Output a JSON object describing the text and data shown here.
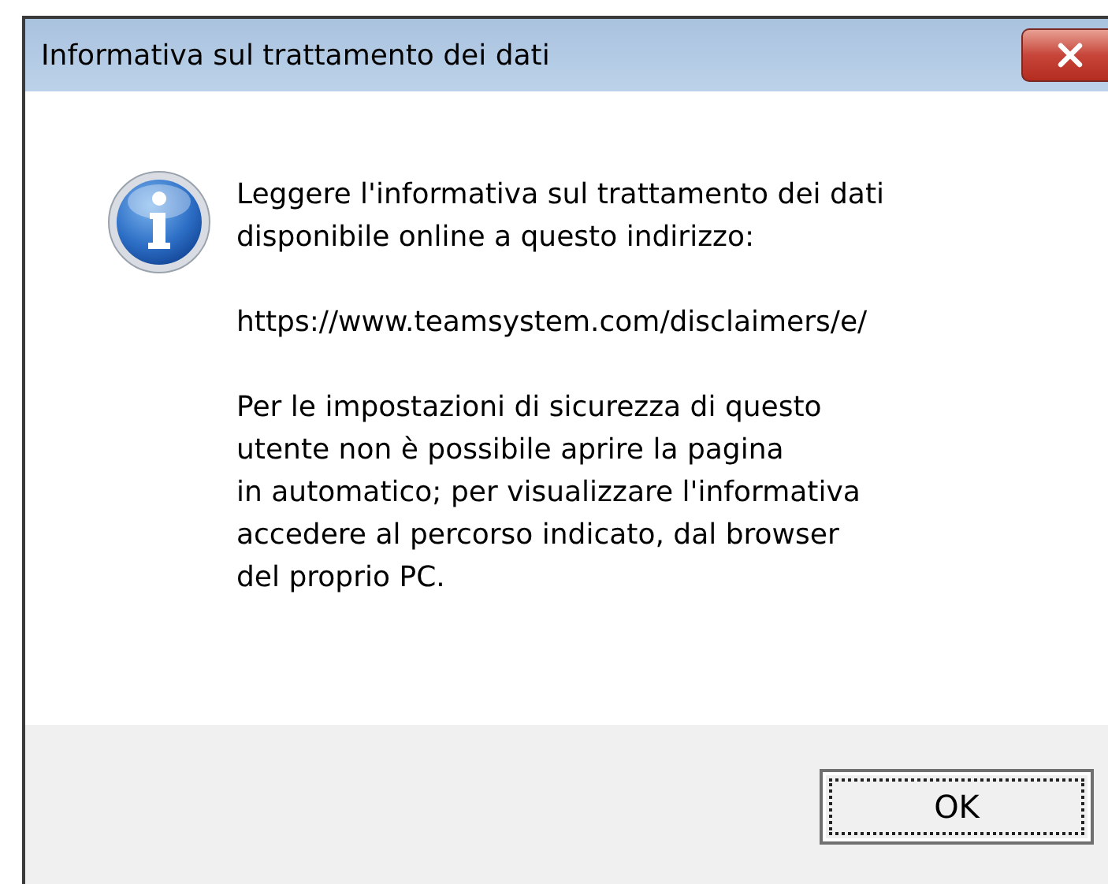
{
  "window": {
    "title": "Informativa sul trattamento dei dati"
  },
  "message": {
    "kind": "info",
    "paragraphs": [
      "Leggere l'informativa sul trattamento dei dati\ndisponibile online a questo indirizzo:",
      "https://www.teamsystem.com/disclaimers/e/",
      "Per le impostazioni di sicurezza di questo\nutente non è possibile aprire la pagina\nin automatico; per visualizzare l'informativa\naccedere al percorso indicato, dal browser\ndel proprio PC."
    ]
  },
  "buttons": [
    {
      "label": "OK",
      "focused": true
    }
  ]
}
